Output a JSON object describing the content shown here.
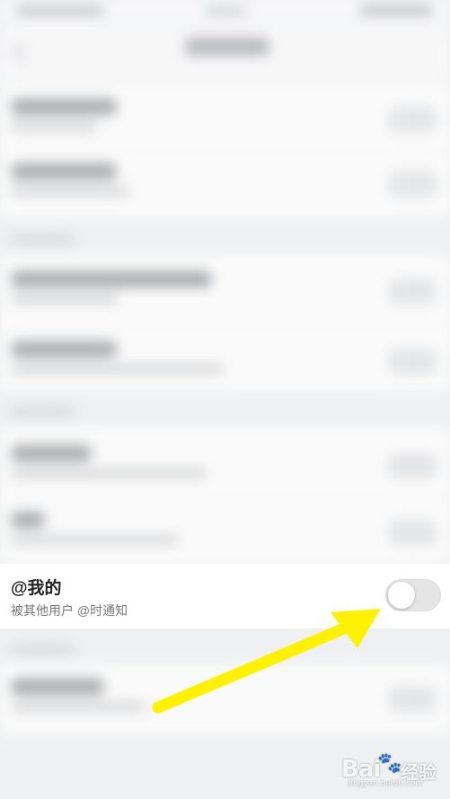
{
  "focused_setting": {
    "title": "@我的",
    "subtitle": "被其他用户 @时通知",
    "toggle_on": false
  },
  "watermark": {
    "brand": "Bai",
    "brand_suffix": "经验",
    "url": "jingyan.baidu.com"
  },
  "colors": {
    "arrow": "#fff200",
    "toggle_off": "#e5e5e5"
  }
}
